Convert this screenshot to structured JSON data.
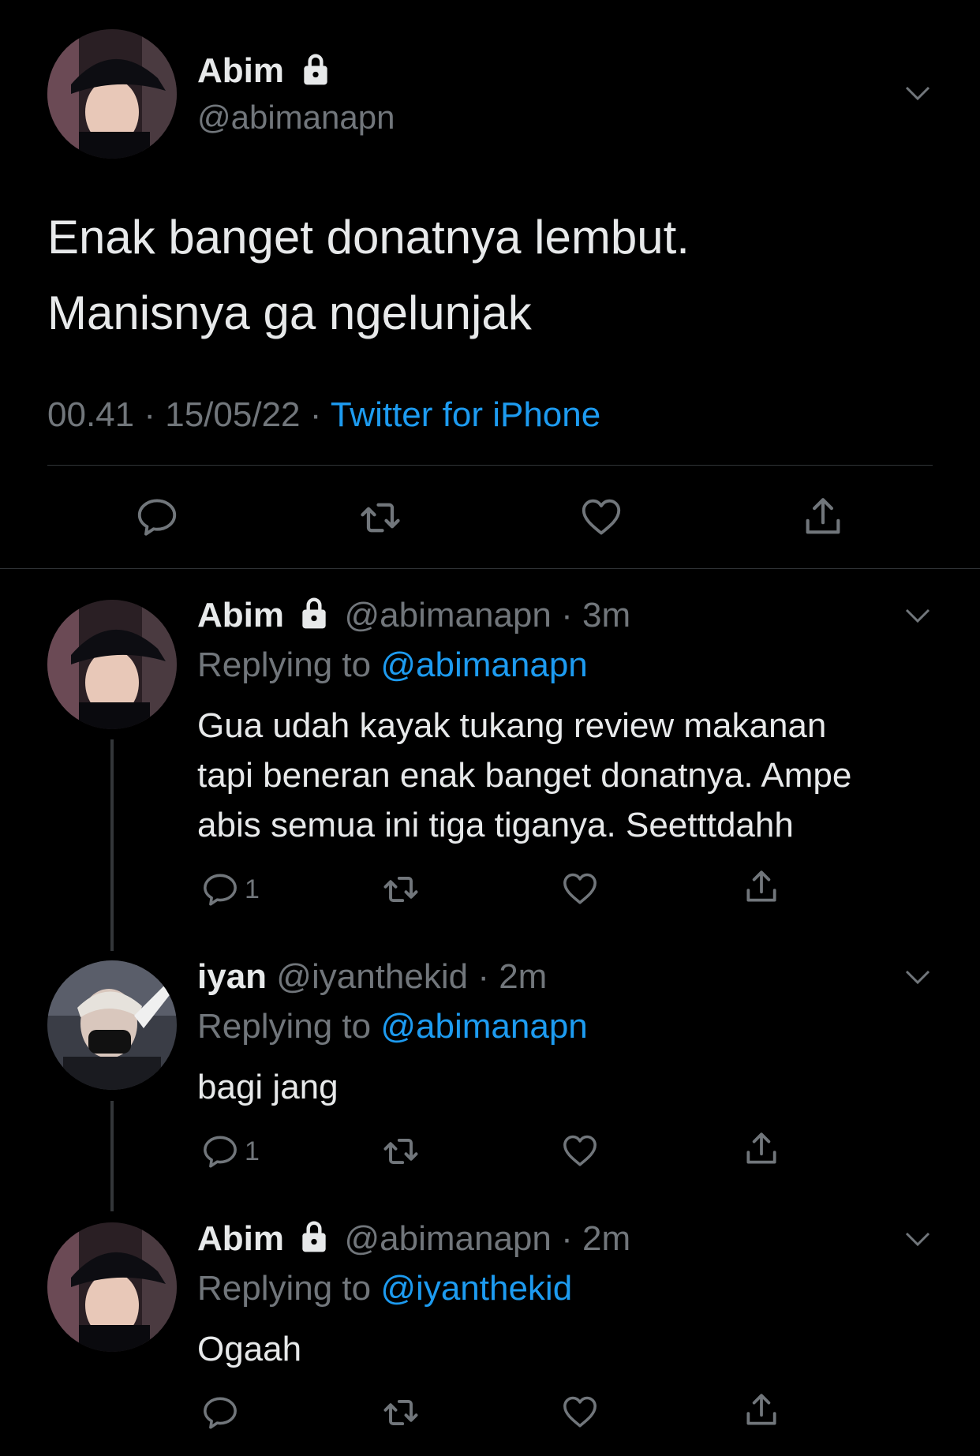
{
  "main_tweet": {
    "author_name": "Abim",
    "handle": "@abimanapn",
    "text_line1": "Enak banget donatnya lembut.",
    "text_line2": "Manisnya ga ngelunjak",
    "time": "00.41",
    "sep1": "·",
    "date": "15/05/22",
    "sep2": "·",
    "source": "Twitter for iPhone"
  },
  "replies": [
    {
      "author_name": "Abim",
      "handle": "@abimanapn",
      "dot": "·",
      "age": "3m",
      "replying_label": "Replying to",
      "replying_to": "@abimanapn",
      "text_line1": "Gua udah kayak tukang review makanan",
      "text_line2": "tapi beneran enak banget donatnya. Ampe",
      "text_line3": "abis semua ini tiga tiganya. Seetttdahh",
      "reply_count": "1",
      "locked": true
    },
    {
      "author_name": "iyan",
      "handle": "@iyanthekid",
      "dot": "·",
      "age": "2m",
      "replying_label": "Replying to",
      "replying_to": "@abimanapn",
      "text_line1": "bagi jang",
      "reply_count": "1",
      "locked": false
    },
    {
      "author_name": "Abim",
      "handle": "@abimanapn",
      "dot": "·",
      "age": "2m",
      "replying_label": "Replying to",
      "replying_to": "@iyanthekid",
      "text_line1": "Ogaah",
      "reply_count": "",
      "locked": true
    }
  ],
  "icons": {
    "reply": "reply-icon",
    "retweet": "retweet-icon",
    "like": "heart-icon",
    "share": "share-icon",
    "lock": "lock-icon",
    "chevron": "chevron-down-icon"
  },
  "colors": {
    "background": "#000000",
    "text": "#e7e9ea",
    "secondary": "#71767b",
    "accent": "#1d9bf0"
  }
}
